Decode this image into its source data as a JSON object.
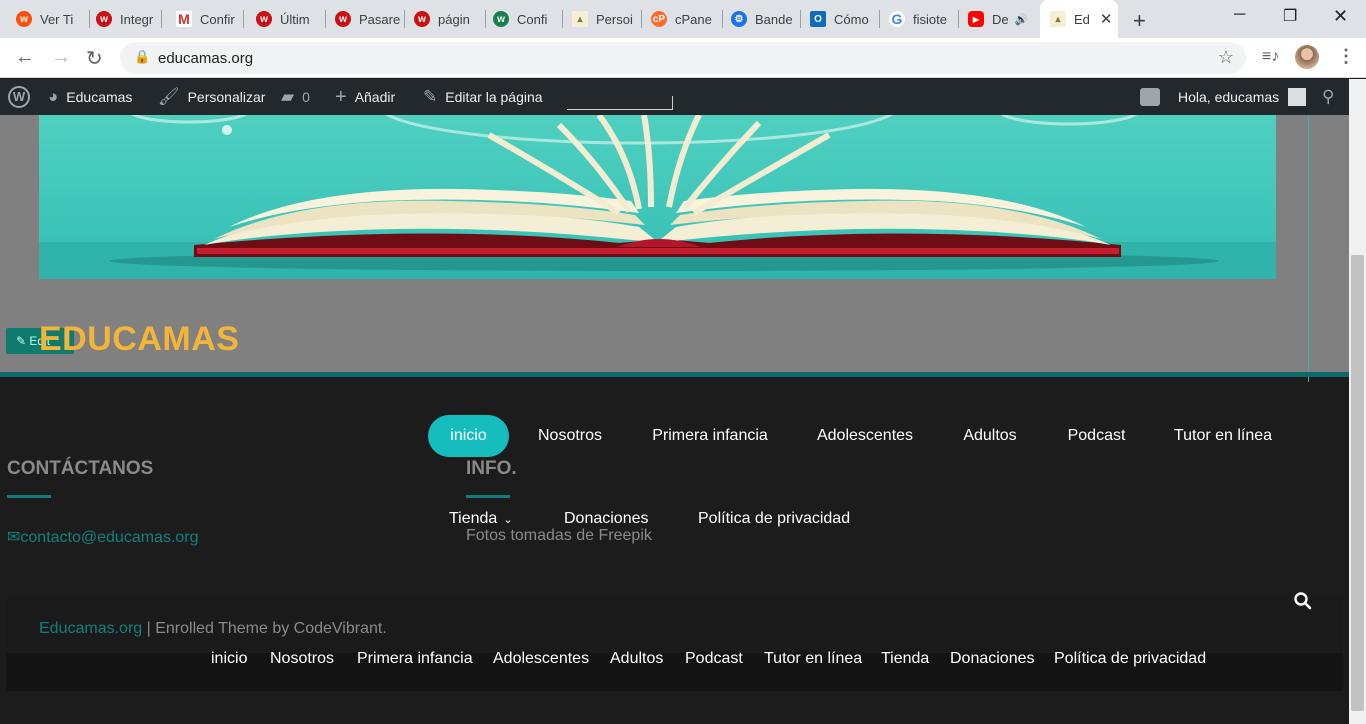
{
  "browser": {
    "tabs": [
      {
        "label": "Ver Ti",
        "icon": "wattpad-icon",
        "color": "#ff500a"
      },
      {
        "label": "Integr",
        "icon": "wattpad-icon",
        "color": "#cc1111"
      },
      {
        "label": "Confir",
        "icon": "gmail-icon",
        "color": "#d93025"
      },
      {
        "label": "Últim",
        "icon": "wattpad-icon",
        "color": "#cc1111"
      },
      {
        "label": "Pasare",
        "icon": "wattpad-icon",
        "color": "#cc1111"
      },
      {
        "label": "págin",
        "icon": "wattpad-icon",
        "color": "#cc1111"
      },
      {
        "label": "Confi",
        "icon": "wattpad-green-icon",
        "color": "#1a7f4b"
      },
      {
        "label": "Persoi",
        "icon": "book-icon",
        "color": "#8a7a40"
      },
      {
        "label": "cPane",
        "icon": "cpanel-icon",
        "color": "#ff6c2c"
      },
      {
        "label": "Bande",
        "icon": "gear-icon",
        "color": "#1a73e8"
      },
      {
        "label": "Cómo",
        "icon": "outlook-icon",
        "color": "#0f6cbd"
      },
      {
        "label": "fisiote",
        "icon": "google-icon",
        "color": "#4285f4"
      },
      {
        "label": "De",
        "icon": "youtube-icon",
        "color": "#ff0000"
      },
      {
        "label": "Ed",
        "icon": "book-icon",
        "color": "#8a7a40"
      }
    ],
    "url": "educamas.org"
  },
  "adminbar": {
    "site": "Educamas",
    "customize": "Personalizar",
    "comments": "0",
    "add": "Añadir",
    "edit": "Editar la página",
    "greeting": "Hola, educamas"
  },
  "site": {
    "title": "EDUCAMAS",
    "edit_badge": "Edit"
  },
  "nav_main": [
    "inicio",
    "Nosotros",
    "Primera infancia",
    "Adolescentes",
    "Adultos",
    "Podcast",
    "Tutor en línea"
  ],
  "nav_sub": {
    "tienda": "Tienda",
    "donaciones": "Donaciones",
    "privacidad": "Política de privacidad"
  },
  "widgets": {
    "contact_title": "CONTÁCTANOS",
    "email": "contacto@educamas.org",
    "info_title": "INFO.",
    "fotos": "Fotos tomadas de Freepik"
  },
  "footer": {
    "credit_link": "Educamas.org",
    "credit_rest": " | Enrolled Theme by CodeVibrant.",
    "links": [
      "inicio",
      "Nosotros",
      "Primera infancia",
      "Adolescentes",
      "Adultos",
      "Podcast",
      "Tutor en línea",
      "Tienda",
      "Donaciones",
      "Política de privacidad"
    ]
  }
}
